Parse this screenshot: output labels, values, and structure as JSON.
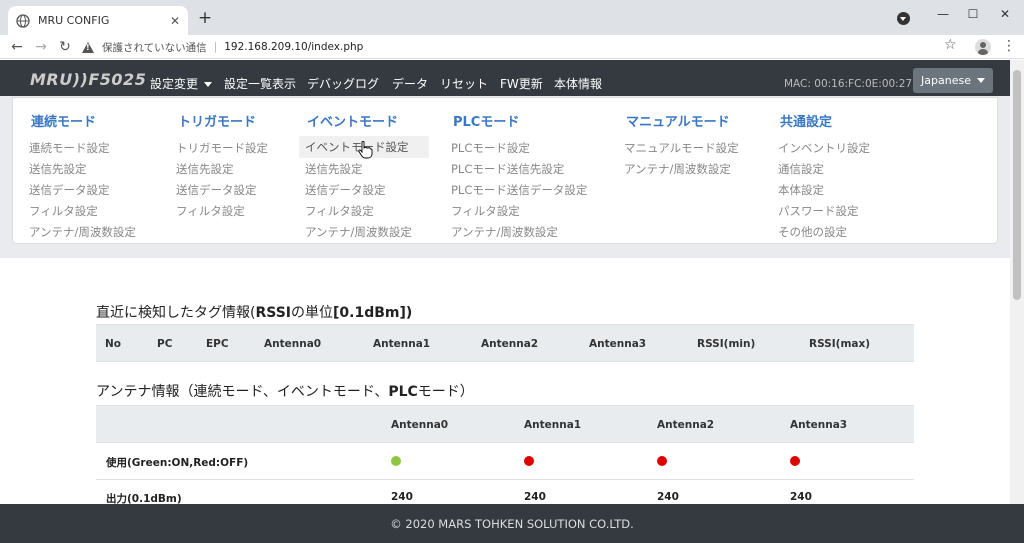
{
  "browser": {
    "tab_title": "MRU CONFIG",
    "insecure_label": "保護されていない通信",
    "url": "192.168.209.10/index.php"
  },
  "navbar": {
    "brand": "MRU))F5025",
    "items": [
      "設定変更",
      "設定一覧表示",
      "デバッグログ",
      "データ",
      "リセット",
      "FW更新",
      "本体情報"
    ],
    "mac": "MAC: 00:16:FC:0E:00:27",
    "language": "Japanese"
  },
  "menu": {
    "columns": [
      {
        "title": "連続モード",
        "items": [
          "連続モード設定",
          "送信先設定",
          "送信データ設定",
          "フィルタ設定",
          "アンテナ/周波数設定"
        ]
      },
      {
        "title": "トリガモード",
        "items": [
          "トリガモード設定",
          "送信先設定",
          "送信データ設定",
          "フィルタ設定"
        ]
      },
      {
        "title": "イベントモード",
        "items": [
          "イベントモード設定",
          "送信先設定",
          "送信データ設定",
          "フィルタ設定",
          "アンテナ/周波数設定"
        ]
      },
      {
        "title": "PLCモード",
        "items": [
          "PLCモード設定",
          "PLCモード送信先設定",
          "PLCモード送信データ設定",
          "フィルタ設定",
          "アンテナ/周波数設定"
        ]
      },
      {
        "title": "マニュアルモード",
        "items": [
          "マニュアルモード設定",
          "アンテナ/周波数設定"
        ]
      },
      {
        "title": "共通設定",
        "items": [
          "インベントリ設定",
          "通信設定",
          "本体設定",
          "パスワード設定",
          "その他の設定"
        ]
      }
    ]
  },
  "tag_section": {
    "title_pre": "直近に検知したタグ情報(",
    "title_bold": "RSSI",
    "title_mid": "の単位",
    "title_unit": "[0.1dBm])",
    "headers": [
      "No",
      "PC",
      "EPC",
      "Antenna0",
      "Antenna1",
      "Antenna2",
      "Antenna3",
      "RSSI(min)",
      "RSSI(max)"
    ]
  },
  "antenna_section": {
    "title_pre": "アンテナ情報（連続モード、イベントモード、",
    "title_bold": "PLC",
    "title_post": "モード）",
    "headers": [
      "",
      "Antenna0",
      "Antenna1",
      "Antenna2",
      "Antenna3"
    ],
    "rows": [
      {
        "label": "使用(Green:ON,Red:OFF)",
        "status": [
          "on",
          "off",
          "off",
          "off"
        ]
      },
      {
        "label": "出力(0.1dBm)",
        "values": [
          "240",
          "240",
          "240",
          "240"
        ]
      }
    ],
    "colors": {
      "on": "#8dc63f",
      "off": "#e00000"
    }
  },
  "footer": {
    "copyright": "© 2020 MARS TOHKEN SOLUTION CO.LTD."
  }
}
